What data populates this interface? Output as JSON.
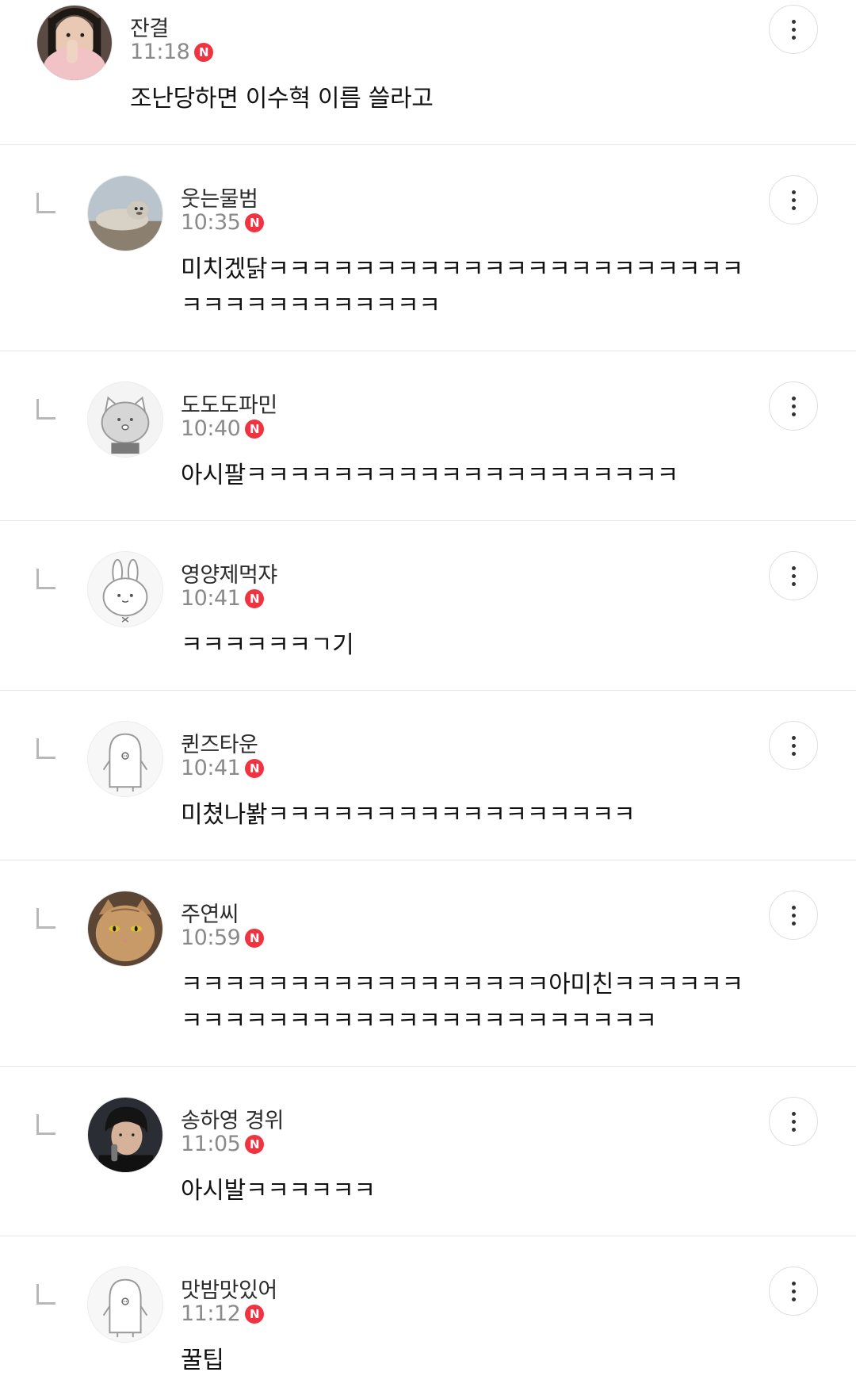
{
  "badge_letter": "N",
  "comments": [
    {
      "nickname": "잔결",
      "time": "11:18",
      "text": "조난당하면 이수혁 이름 쓸라고",
      "avatar": "profile-photo-pink-scarf",
      "is_reply": false
    },
    {
      "nickname": "웃는물범",
      "time": "10:35",
      "text": "미치겠닭ㅋㅋㅋㅋㅋㅋㅋㅋㅋㅋㅋㅋㅋㅋㅋㅋㅋㅋㅋㅋㅋㅋㅋㅋㅋㅋㅋㅋㅋㅋㅋㅋㅋㅋ",
      "avatar": "seal-photo",
      "is_reply": true
    },
    {
      "nickname": "도도도파민",
      "time": "10:40",
      "text": "아시팔ㅋㅋㅋㅋㅋㅋㅋㅋㅋㅋㅋㅋㅋㅋㅋㅋㅋㅋㅋㅋ",
      "avatar": "default-cat-avatar",
      "is_reply": true
    },
    {
      "nickname": "영양제먹쟈",
      "time": "10:41",
      "text": "ㅋㅋㅋㅋㅋㅋㄱ기",
      "avatar": "default-rabbit-avatar",
      "is_reply": true
    },
    {
      "nickname": "퀸즈타운",
      "time": "10:41",
      "text": "미쳤나봙ㅋㅋㅋㅋㅋㅋㅋㅋㅋㅋㅋㅋㅋㅋㅋㅋㅋ",
      "avatar": "default-penguin-avatar",
      "is_reply": true
    },
    {
      "nickname": "주연씨",
      "time": "10:59",
      "text": "ㅋㅋㅋㅋㅋㅋㅋㅋㅋㅋㅋㅋㅋㅋㅋㅋㅋ아미친ㅋㅋㅋㅋㅋㅋㅋㅋㅋㅋㅋㅋㅋㅋㅋㅋㅋㅋㅋㅋㅋㅋㅋㅋㅋㅋㅋㅋ",
      "avatar": "cat-photo",
      "is_reply": true
    },
    {
      "nickname": "송하영 경위",
      "time": "11:05",
      "text": "아시발ㅋㅋㅋㅋㅋㅋ",
      "avatar": "profile-photo-man",
      "is_reply": true
    },
    {
      "nickname": "맛밤맛있어",
      "time": "11:12",
      "text": "꿀팁",
      "avatar": "default-penguin-avatar",
      "is_reply": true
    }
  ]
}
